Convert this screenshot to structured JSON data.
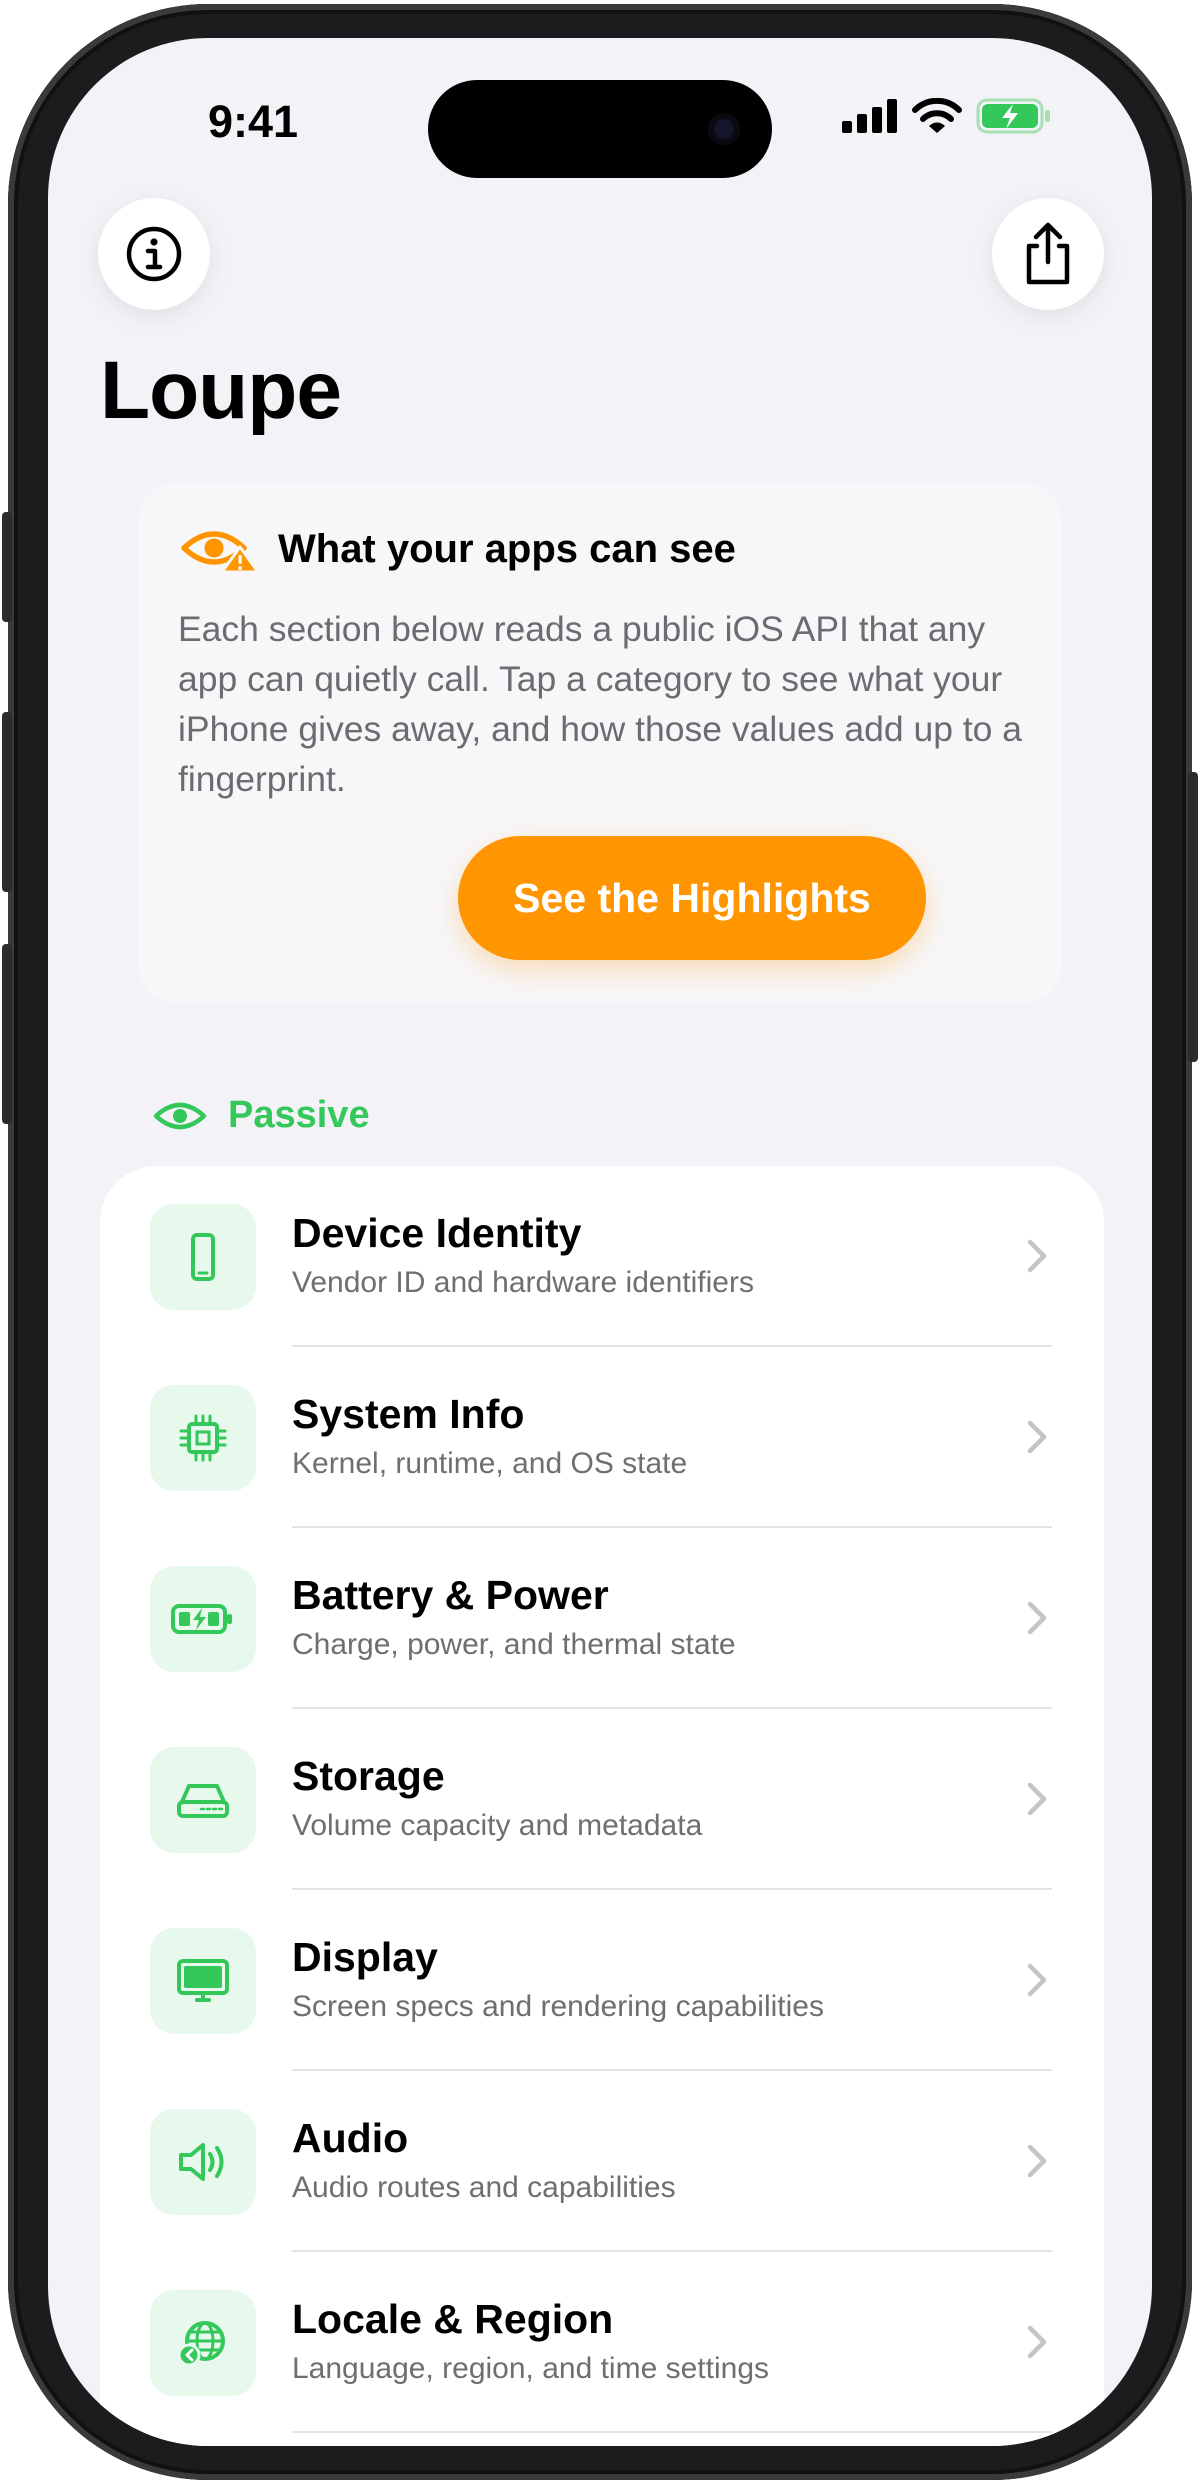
{
  "status_bar": {
    "time": "9:41"
  },
  "header": {
    "title": "Loupe"
  },
  "intro": {
    "title": "What your apps can see",
    "body": "Each section below reads a public iOS API that any app can quietly call. Tap a category to see what your iPhone gives away, and how those values add up to a fingerprint.",
    "button_label": "See the Highlights"
  },
  "section": {
    "label": "Passive"
  },
  "colors": {
    "accent_orange": "#ff9500",
    "accent_green": "#34c759",
    "icon_bg": "#e7f8ec"
  },
  "list": {
    "items": [
      {
        "title": "Device Identity",
        "subtitle": "Vendor ID and hardware identifiers",
        "icon": "iphone-icon"
      },
      {
        "title": "System Info",
        "subtitle": "Kernel, runtime, and OS state",
        "icon": "cpu-chip-icon"
      },
      {
        "title": "Battery & Power",
        "subtitle": "Charge, power, and thermal state",
        "icon": "battery-charging-icon"
      },
      {
        "title": "Storage",
        "subtitle": "Volume capacity and metadata",
        "icon": "storage-drive-icon"
      },
      {
        "title": "Display",
        "subtitle": "Screen specs and rendering capabilities",
        "icon": "display-icon"
      },
      {
        "title": "Audio",
        "subtitle": "Audio routes and capabilities",
        "icon": "speaker-icon"
      },
      {
        "title": "Locale & Region",
        "subtitle": "Language, region, and time settings",
        "icon": "globe-icon"
      }
    ]
  }
}
